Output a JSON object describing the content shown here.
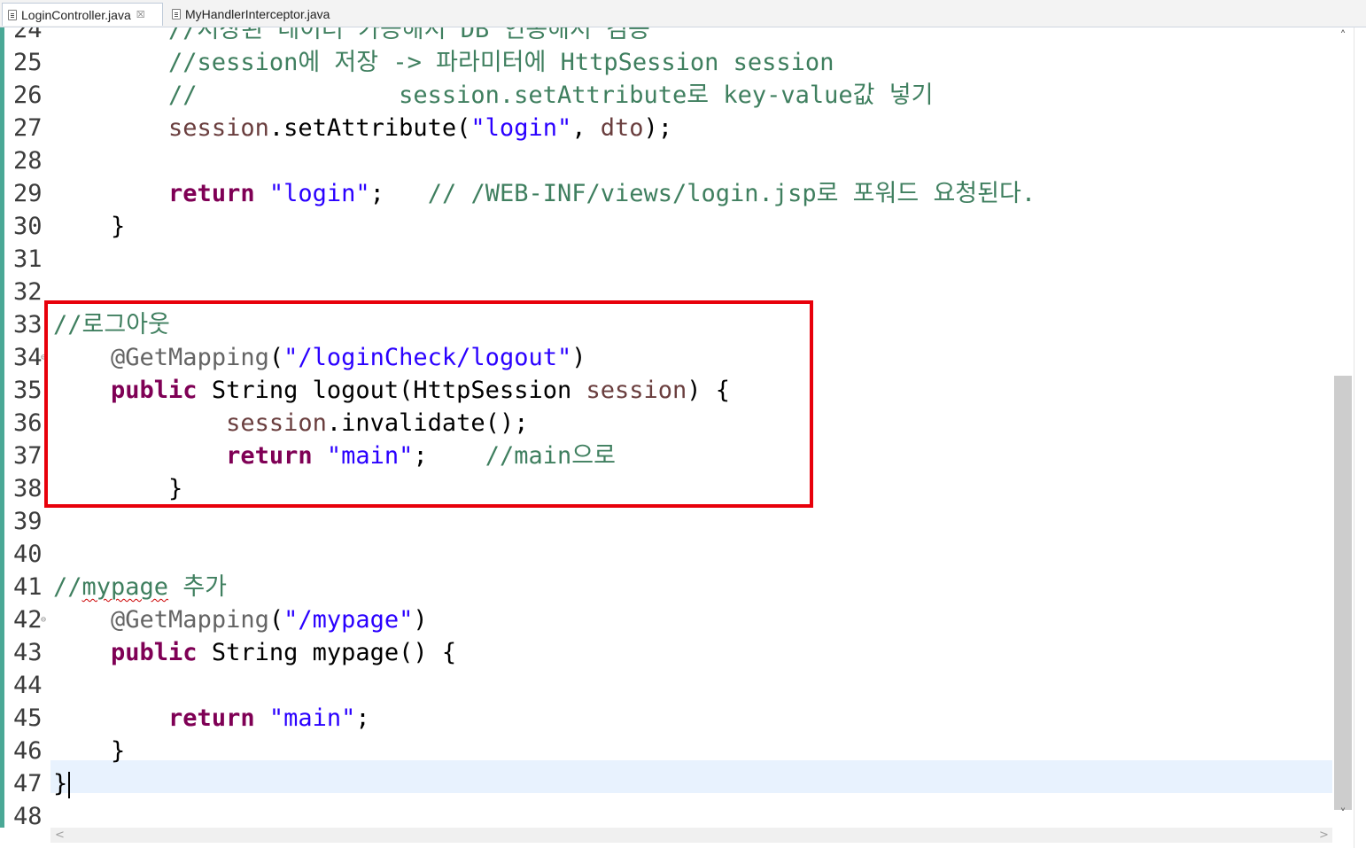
{
  "tabs": [
    {
      "label": "LoginController.java",
      "close": "☒"
    },
    {
      "label": "MyHandlerInterceptor.java"
    }
  ],
  "scrollbar": {
    "up": "˄",
    "down": "˅",
    "left": "<",
    "right": ">",
    "thumb_fraction": 0.54
  },
  "lines": [
    {
      "n": "24",
      "frag": [
        {
          "t": "        //저장된 데이터 가공해서 DB 연동해서 검증",
          "c": "c"
        }
      ]
    },
    {
      "n": "25",
      "frag": [
        {
          "t": "        //session에 저장 -> 파라미터에 HttpSession session",
          "c": "c"
        }
      ]
    },
    {
      "n": "26",
      "frag": [
        {
          "t": "        //              session.setAttribute로 key-value값 넣기",
          "c": "c"
        }
      ]
    },
    {
      "n": "27",
      "frag": [
        {
          "t": "        ",
          "c": ""
        },
        {
          "t": "session",
          "c": "v"
        },
        {
          "t": ".setAttribute(",
          "c": ""
        },
        {
          "t": "\"login\"",
          "c": "s"
        },
        {
          "t": ", ",
          "c": ""
        },
        {
          "t": "dto",
          "c": "v"
        },
        {
          "t": ");",
          "c": ""
        }
      ]
    },
    {
      "n": "28",
      "frag": []
    },
    {
      "n": "29",
      "frag": [
        {
          "t": "        ",
          "c": ""
        },
        {
          "t": "return",
          "c": "k"
        },
        {
          "t": " ",
          "c": ""
        },
        {
          "t": "\"login\"",
          "c": "s"
        },
        {
          "t": ";   ",
          "c": ""
        },
        {
          "t": "// /WEB-INF/views/login.jsp로 포워드 요청된다.",
          "c": "c"
        }
      ]
    },
    {
      "n": "30",
      "frag": [
        {
          "t": "    }",
          "c": ""
        }
      ]
    },
    {
      "n": "31",
      "frag": []
    },
    {
      "n": "32",
      "frag": []
    },
    {
      "n": "33",
      "frag": [
        {
          "t": "//로그아웃",
          "c": "c"
        }
      ]
    },
    {
      "n": "34",
      "fold": true,
      "frag": [
        {
          "t": "    ",
          "c": ""
        },
        {
          "t": "@GetMapping",
          "c": "a"
        },
        {
          "t": "(",
          "c": ""
        },
        {
          "t": "\"/loginCheck/logout\"",
          "c": "s"
        },
        {
          "t": ")",
          "c": ""
        }
      ]
    },
    {
      "n": "35",
      "frag": [
        {
          "t": "    ",
          "c": ""
        },
        {
          "t": "public",
          "c": "k"
        },
        {
          "t": " String logout(HttpSession ",
          "c": ""
        },
        {
          "t": "session",
          "c": "v"
        },
        {
          "t": ") {",
          "c": ""
        }
      ]
    },
    {
      "n": "36",
      "frag": [
        {
          "t": "            ",
          "c": ""
        },
        {
          "t": "session",
          "c": "v"
        },
        {
          "t": ".invalidate();",
          "c": ""
        }
      ]
    },
    {
      "n": "37",
      "frag": [
        {
          "t": "            ",
          "c": ""
        },
        {
          "t": "return",
          "c": "k"
        },
        {
          "t": " ",
          "c": ""
        },
        {
          "t": "\"main\"",
          "c": "s"
        },
        {
          "t": ";    ",
          "c": ""
        },
        {
          "t": "//main으로",
          "c": "c"
        }
      ]
    },
    {
      "n": "38",
      "frag": [
        {
          "t": "        }",
          "c": ""
        }
      ]
    },
    {
      "n": "39",
      "frag": []
    },
    {
      "n": "40",
      "frag": []
    },
    {
      "n": "41",
      "frag": [
        {
          "t": "//",
          "c": "c"
        },
        {
          "t": "mypage",
          "c": "c squiggle"
        },
        {
          "t": " 추가",
          "c": "c"
        }
      ]
    },
    {
      "n": "42",
      "fold": true,
      "frag": [
        {
          "t": "    ",
          "c": ""
        },
        {
          "t": "@GetMapping",
          "c": "a"
        },
        {
          "t": "(",
          "c": ""
        },
        {
          "t": "\"/mypage\"",
          "c": "s"
        },
        {
          "t": ")",
          "c": ""
        }
      ]
    },
    {
      "n": "43",
      "frag": [
        {
          "t": "    ",
          "c": ""
        },
        {
          "t": "public",
          "c": "k"
        },
        {
          "t": " String mypage() {",
          "c": ""
        }
      ]
    },
    {
      "n": "44",
      "frag": []
    },
    {
      "n": "45",
      "frag": [
        {
          "t": "        ",
          "c": ""
        },
        {
          "t": "return",
          "c": "k"
        },
        {
          "t": " ",
          "c": ""
        },
        {
          "t": "\"main\"",
          "c": "s"
        },
        {
          "t": ";",
          "c": ""
        }
      ]
    },
    {
      "n": "46",
      "frag": [
        {
          "t": "    }",
          "c": ""
        }
      ]
    },
    {
      "n": "47",
      "caret": true,
      "frag": [
        {
          "t": "}",
          "c": ""
        }
      ]
    },
    {
      "n": "48",
      "frag": []
    }
  ]
}
